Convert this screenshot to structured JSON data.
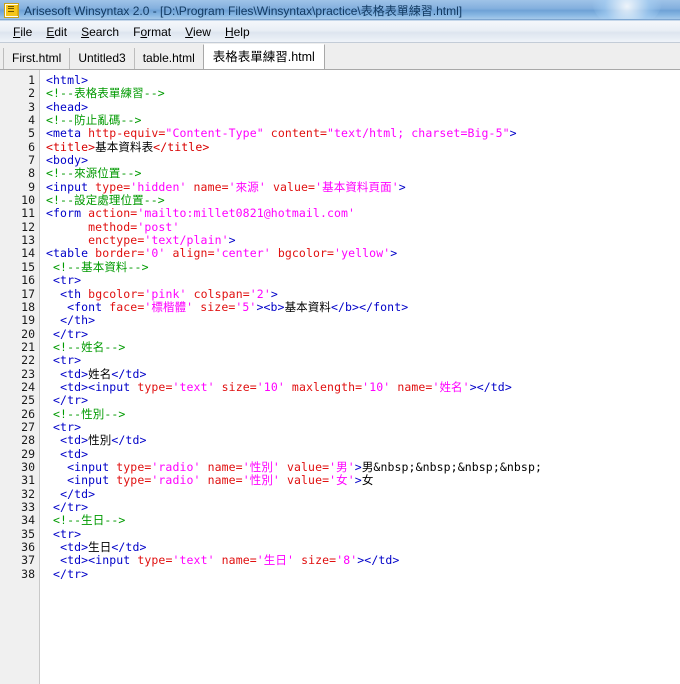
{
  "window": {
    "title": "Arisesoft Winsyntax 2.0 - [D:\\Program Files\\Winsyntax\\practice\\表格表單練習.html]",
    "icon": "document-icon"
  },
  "menubar": {
    "items": [
      {
        "label": "File",
        "mnemonic": "F"
      },
      {
        "label": "Edit",
        "mnemonic": "E"
      },
      {
        "label": "Search",
        "mnemonic": "S"
      },
      {
        "label": "Format",
        "mnemonic": "o"
      },
      {
        "label": "View",
        "mnemonic": "V"
      },
      {
        "label": "Help",
        "mnemonic": "H"
      }
    ]
  },
  "tabs": {
    "active_index": 3,
    "items": [
      {
        "label": "First.html"
      },
      {
        "label": "Untitled3"
      },
      {
        "label": "table.html"
      },
      {
        "label": "表格表單練習.html"
      }
    ]
  },
  "editor": {
    "first_line": 1,
    "last_line": 38,
    "line_numbers": [
      1,
      2,
      3,
      4,
      5,
      6,
      7,
      8,
      9,
      10,
      11,
      12,
      13,
      14,
      15,
      16,
      17,
      18,
      19,
      20,
      21,
      22,
      23,
      24,
      25,
      26,
      27,
      28,
      29,
      30,
      31,
      32,
      33,
      34,
      35,
      36,
      37,
      38
    ],
    "syntax_colors": {
      "tag": "#0000c8",
      "tag_alt": "#d80000",
      "attribute": "#e01010",
      "string": "#ff00ff",
      "comment": "#009a00",
      "text": "#000000"
    },
    "lines": [
      {
        "n": 1,
        "text": "<html>"
      },
      {
        "n": 2,
        "text": "<!--表格表單練習-->"
      },
      {
        "n": 3,
        "text": "<head>"
      },
      {
        "n": 4,
        "text": "<!--防止亂碼-->"
      },
      {
        "n": 5,
        "text": "<meta http-equiv=\"Content-Type\" content=\"text/html; charset=Big-5\">"
      },
      {
        "n": 6,
        "text": "<title>基本資料表</title>"
      },
      {
        "n": 7,
        "text": "<body>"
      },
      {
        "n": 8,
        "text": "<!--來源位置-->"
      },
      {
        "n": 9,
        "text": "<input type='hidden' name='來源' value='基本資料頁面'>"
      },
      {
        "n": 10,
        "text": "<!--設定處理位置-->"
      },
      {
        "n": 11,
        "text": "<form action='mailto:millet0821@hotmail.com'"
      },
      {
        "n": 12,
        "text": "      method='post'"
      },
      {
        "n": 13,
        "text": "      enctype='text/plain'>"
      },
      {
        "n": 14,
        "text": "<table border='0' align='center' bgcolor='yellow'>"
      },
      {
        "n": 15,
        "text": " <!--基本資料-->"
      },
      {
        "n": 16,
        "text": " <tr>"
      },
      {
        "n": 17,
        "text": "  <th bgcolor='pink' colspan='2'>"
      },
      {
        "n": 18,
        "text": "   <font face='標楷體' size='5'><b>基本資料</b></font>"
      },
      {
        "n": 19,
        "text": "  </th>"
      },
      {
        "n": 20,
        "text": " </tr>"
      },
      {
        "n": 21,
        "text": " <!--姓名-->"
      },
      {
        "n": 22,
        "text": " <tr>"
      },
      {
        "n": 23,
        "text": "  <td>姓名</td>"
      },
      {
        "n": 24,
        "text": "  <td><input type='text' size='10' maxlength='10' name='姓名'></td>"
      },
      {
        "n": 25,
        "text": " </tr>"
      },
      {
        "n": 26,
        "text": " <!--性別-->"
      },
      {
        "n": 27,
        "text": " <tr>"
      },
      {
        "n": 28,
        "text": "  <td>性別</td>"
      },
      {
        "n": 29,
        "text": "  <td>"
      },
      {
        "n": 30,
        "text": "   <input type='radio' name='性別' value='男'>男&nbsp;&nbsp;&nbsp;&nbsp;"
      },
      {
        "n": 31,
        "text": "   <input type='radio' name='性別' value='女'>女"
      },
      {
        "n": 32,
        "text": "  </td>"
      },
      {
        "n": 33,
        "text": " </tr>"
      },
      {
        "n": 34,
        "text": " <!--生日-->"
      },
      {
        "n": 35,
        "text": " <tr>"
      },
      {
        "n": 36,
        "text": "  <td>生日</td>"
      },
      {
        "n": 37,
        "text": "  <td><input type='text' name='生日' size='8'></td>"
      },
      {
        "n": 38,
        "text": " </tr>"
      }
    ],
    "tokens": [
      [
        [
          "t",
          "<html>"
        ]
      ],
      [
        [
          "c",
          "<!--表格表單練習-->"
        ]
      ],
      [
        [
          "t",
          "<head>"
        ]
      ],
      [
        [
          "c",
          "<!--防止亂碼-->"
        ]
      ],
      [
        [
          "t",
          "<meta "
        ],
        [
          "a",
          "http-equiv="
        ],
        [
          "s",
          "\"Content-Type\""
        ],
        [
          "t",
          " "
        ],
        [
          "a",
          "content="
        ],
        [
          "s",
          "\"text/html; charset=Big-5\""
        ],
        [
          "t",
          ">"
        ]
      ],
      [
        [
          "tr",
          "<title>"
        ],
        [
          "x",
          "基本資料表"
        ],
        [
          "tr",
          "</title>"
        ]
      ],
      [
        [
          "t",
          "<body>"
        ]
      ],
      [
        [
          "c",
          "<!--來源位置-->"
        ]
      ],
      [
        [
          "t",
          "<input "
        ],
        [
          "a",
          "type="
        ],
        [
          "s",
          "'hidden'"
        ],
        [
          "t",
          " "
        ],
        [
          "a",
          "name="
        ],
        [
          "s",
          "'來源'"
        ],
        [
          "t",
          " "
        ],
        [
          "a",
          "value="
        ],
        [
          "s",
          "'基本資料頁面'"
        ],
        [
          "t",
          ">"
        ]
      ],
      [
        [
          "c",
          "<!--設定處理位置-->"
        ]
      ],
      [
        [
          "t",
          "<form "
        ],
        [
          "a",
          "action="
        ],
        [
          "s",
          "'mailto:millet0821@hotmail.com'"
        ]
      ],
      [
        [
          "x",
          "      "
        ],
        [
          "a",
          "method="
        ],
        [
          "s",
          "'post'"
        ]
      ],
      [
        [
          "x",
          "      "
        ],
        [
          "a",
          "enctype="
        ],
        [
          "s",
          "'text/plain'"
        ],
        [
          "t",
          ">"
        ]
      ],
      [
        [
          "t",
          "<table "
        ],
        [
          "a",
          "border="
        ],
        [
          "s",
          "'0'"
        ],
        [
          "t",
          " "
        ],
        [
          "a",
          "align="
        ],
        [
          "s",
          "'center'"
        ],
        [
          "t",
          " "
        ],
        [
          "a",
          "bgcolor="
        ],
        [
          "s",
          "'yellow'"
        ],
        [
          "t",
          ">"
        ]
      ],
      [
        [
          "x",
          " "
        ],
        [
          "c",
          "<!--基本資料-->"
        ]
      ],
      [
        [
          "x",
          " "
        ],
        [
          "t",
          "<tr>"
        ]
      ],
      [
        [
          "x",
          "  "
        ],
        [
          "t",
          "<th "
        ],
        [
          "a",
          "bgcolor="
        ],
        [
          "s",
          "'pink'"
        ],
        [
          "t",
          " "
        ],
        [
          "a",
          "colspan="
        ],
        [
          "s",
          "'2'"
        ],
        [
          "t",
          ">"
        ]
      ],
      [
        [
          "x",
          "   "
        ],
        [
          "t",
          "<font "
        ],
        [
          "a",
          "face="
        ],
        [
          "s",
          "'標楷體'"
        ],
        [
          "t",
          " "
        ],
        [
          "a",
          "size="
        ],
        [
          "s",
          "'5'"
        ],
        [
          "t",
          ">"
        ],
        [
          "t",
          "<b>"
        ],
        [
          "x",
          "基本資料"
        ],
        [
          "t",
          "</b>"
        ],
        [
          "t",
          "</font>"
        ]
      ],
      [
        [
          "x",
          "  "
        ],
        [
          "t",
          "</th>"
        ]
      ],
      [
        [
          "x",
          " "
        ],
        [
          "t",
          "</tr>"
        ]
      ],
      [
        [
          "x",
          " "
        ],
        [
          "c",
          "<!--姓名-->"
        ]
      ],
      [
        [
          "x",
          " "
        ],
        [
          "t",
          "<tr>"
        ]
      ],
      [
        [
          "x",
          "  "
        ],
        [
          "t",
          "<td>"
        ],
        [
          "x",
          "姓名"
        ],
        [
          "t",
          "</td>"
        ]
      ],
      [
        [
          "x",
          "  "
        ],
        [
          "t",
          "<td>"
        ],
        [
          "t",
          "<input "
        ],
        [
          "a",
          "type="
        ],
        [
          "s",
          "'text'"
        ],
        [
          "t",
          " "
        ],
        [
          "a",
          "size="
        ],
        [
          "s",
          "'10'"
        ],
        [
          "t",
          " "
        ],
        [
          "a",
          "maxlength="
        ],
        [
          "s",
          "'10'"
        ],
        [
          "t",
          " "
        ],
        [
          "a",
          "name="
        ],
        [
          "s",
          "'姓名'"
        ],
        [
          "t",
          ">"
        ],
        [
          "t",
          "</td>"
        ]
      ],
      [
        [
          "x",
          " "
        ],
        [
          "t",
          "</tr>"
        ]
      ],
      [
        [
          "x",
          " "
        ],
        [
          "c",
          "<!--性別-->"
        ]
      ],
      [
        [
          "x",
          " "
        ],
        [
          "t",
          "<tr>"
        ]
      ],
      [
        [
          "x",
          "  "
        ],
        [
          "t",
          "<td>"
        ],
        [
          "x",
          "性別"
        ],
        [
          "t",
          "</td>"
        ]
      ],
      [
        [
          "x",
          "  "
        ],
        [
          "t",
          "<td>"
        ]
      ],
      [
        [
          "x",
          "   "
        ],
        [
          "t",
          "<input "
        ],
        [
          "a",
          "type="
        ],
        [
          "s",
          "'radio'"
        ],
        [
          "t",
          " "
        ],
        [
          "a",
          "name="
        ],
        [
          "s",
          "'性別'"
        ],
        [
          "t",
          " "
        ],
        [
          "a",
          "value="
        ],
        [
          "s",
          "'男'"
        ],
        [
          "t",
          ">"
        ],
        [
          "x",
          "男&nbsp;&nbsp;&nbsp;&nbsp;"
        ]
      ],
      [
        [
          "x",
          "   "
        ],
        [
          "t",
          "<input "
        ],
        [
          "a",
          "type="
        ],
        [
          "s",
          "'radio'"
        ],
        [
          "t",
          " "
        ],
        [
          "a",
          "name="
        ],
        [
          "s",
          "'性別'"
        ],
        [
          "t",
          " "
        ],
        [
          "a",
          "value="
        ],
        [
          "s",
          "'女'"
        ],
        [
          "t",
          ">"
        ],
        [
          "x",
          "女"
        ]
      ],
      [
        [
          "x",
          "  "
        ],
        [
          "t",
          "</td>"
        ]
      ],
      [
        [
          "x",
          " "
        ],
        [
          "t",
          "</tr>"
        ]
      ],
      [
        [
          "x",
          " "
        ],
        [
          "c",
          "<!--生日-->"
        ]
      ],
      [
        [
          "x",
          " "
        ],
        [
          "t",
          "<tr>"
        ]
      ],
      [
        [
          "x",
          "  "
        ],
        [
          "t",
          "<td>"
        ],
        [
          "x",
          "生日"
        ],
        [
          "t",
          "</td>"
        ]
      ],
      [
        [
          "x",
          "  "
        ],
        [
          "t",
          "<td>"
        ],
        [
          "t",
          "<input "
        ],
        [
          "a",
          "type="
        ],
        [
          "s",
          "'text'"
        ],
        [
          "t",
          " "
        ],
        [
          "a",
          "name="
        ],
        [
          "s",
          "'生日'"
        ],
        [
          "t",
          " "
        ],
        [
          "a",
          "size="
        ],
        [
          "s",
          "'8'"
        ],
        [
          "t",
          ">"
        ],
        [
          "t",
          "</td>"
        ]
      ],
      [
        [
          "x",
          " "
        ],
        [
          "t",
          "</tr>"
        ]
      ]
    ]
  }
}
